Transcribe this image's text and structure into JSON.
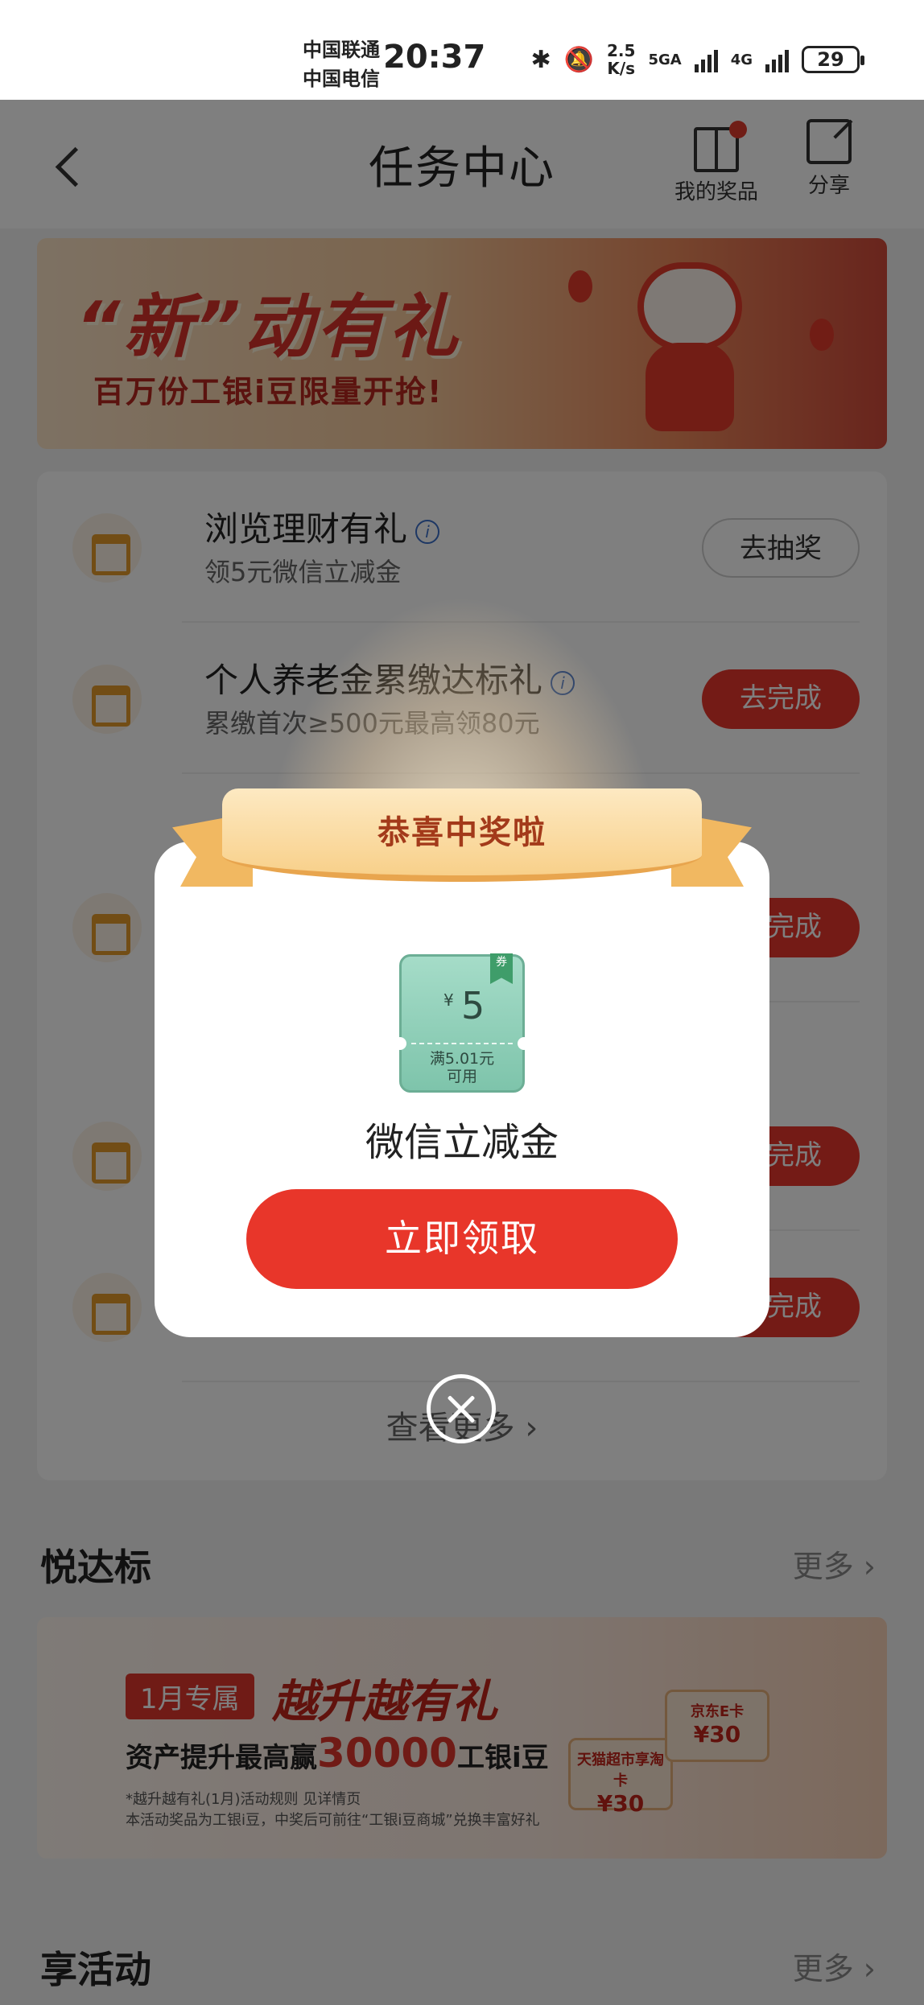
{
  "status_bar": {
    "carrier_1": "中国联通",
    "carrier_2": "中国电信",
    "time": "20:37",
    "net_speed_value": "2.5",
    "net_speed_unit": "K/s",
    "net_type_1": "5GA",
    "net_type_2": "4G",
    "battery": "29"
  },
  "header": {
    "title": "任务中心",
    "my_prizes_label": "我的奖品",
    "share_label": "分享"
  },
  "banner": {
    "title": "“新”动有礼",
    "subtitle": "百万份工银i豆限量开抢!"
  },
  "tasks": [
    {
      "name": "浏览理财有礼",
      "desc": "领5元微信立减金",
      "button": "去抽奖",
      "button_style": "outline"
    },
    {
      "name": "个人养老金累缴达标礼",
      "desc": "累缴首次≥500元最高领80元",
      "button": "去完成",
      "button_style": "solid"
    },
    {
      "name": "",
      "desc": "",
      "button": "去完成",
      "button_style": "solid"
    },
    {
      "name": "",
      "desc": "",
      "button": "去完成",
      "button_style": "solid"
    },
    {
      "name": "",
      "desc": "",
      "button": "去完成",
      "button_style": "solid"
    }
  ],
  "task_card": {
    "view_more": "查看更多"
  },
  "section_1": {
    "title": "悦达标",
    "more": "更多"
  },
  "promo": {
    "tag": "1月专属",
    "title": "越升越有礼",
    "line_prefix": "资产提升最高赢",
    "line_amount": "30000",
    "line_suffix": "工银i豆",
    "note_1": "*越升越有礼(1月)活动规则 见详情页",
    "note_2": "本活动奖品为工银i豆，中奖后可前往“工银i豆商城”兑换丰富好礼",
    "card_1_title": "天猫超市享淘卡",
    "card_1_value": "¥30",
    "card_2_title": "京东E卡",
    "card_2_value": "¥30"
  },
  "section_2": {
    "title": "享活动",
    "more": "更多"
  },
  "modal": {
    "ribbon_text": "恭喜中奖啦",
    "coupon_currency": "¥",
    "coupon_amount": "5",
    "coupon_condition_1": "满5.01元",
    "coupon_condition_2": "可用",
    "coupon_badge": "券",
    "prize_name": "微信立减金",
    "claim_button": "立即领取"
  },
  "colors": {
    "accent_red": "#e8362a",
    "coupon_green": "#7ec4ab",
    "ribbon_gold": "#f8d08a"
  }
}
